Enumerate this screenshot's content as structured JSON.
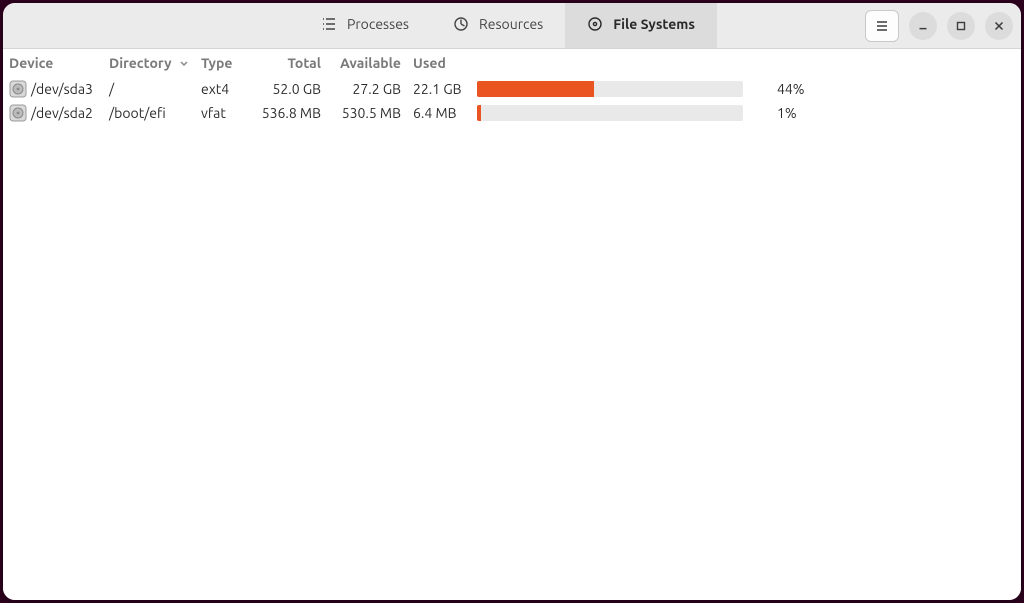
{
  "window": {
    "tabs": [
      {
        "id": "processes",
        "label": "Processes",
        "icon": "processes-icon"
      },
      {
        "id": "resources",
        "label": "Resources",
        "icon": "resources-icon"
      },
      {
        "id": "file-systems",
        "label": "File Systems",
        "icon": "filesystems-icon"
      }
    ],
    "active_tab": "file-systems"
  },
  "table": {
    "columns": {
      "device": "Device",
      "directory": "Directory",
      "type": "Type",
      "total": "Total",
      "available": "Available",
      "used": "Used"
    },
    "sort_column": "directory",
    "sort_dir": "asc",
    "rows": [
      {
        "device": "/dev/sda3",
        "directory": "/",
        "type": "ext4",
        "total": "52.0 GB",
        "available": "27.2 GB",
        "used": "22.1 GB",
        "percent_label": "44%",
        "percent_value": 44
      },
      {
        "device": "/dev/sda2",
        "directory": "/boot/efi",
        "type": "vfat",
        "total": "536.8 MB",
        "available": "530.5 MB",
        "used": "6.4 MB",
        "percent_label": "1%",
        "percent_value": 1
      }
    ]
  },
  "colors": {
    "accent": "#e95420",
    "bar_bg": "#e9e9e9"
  }
}
